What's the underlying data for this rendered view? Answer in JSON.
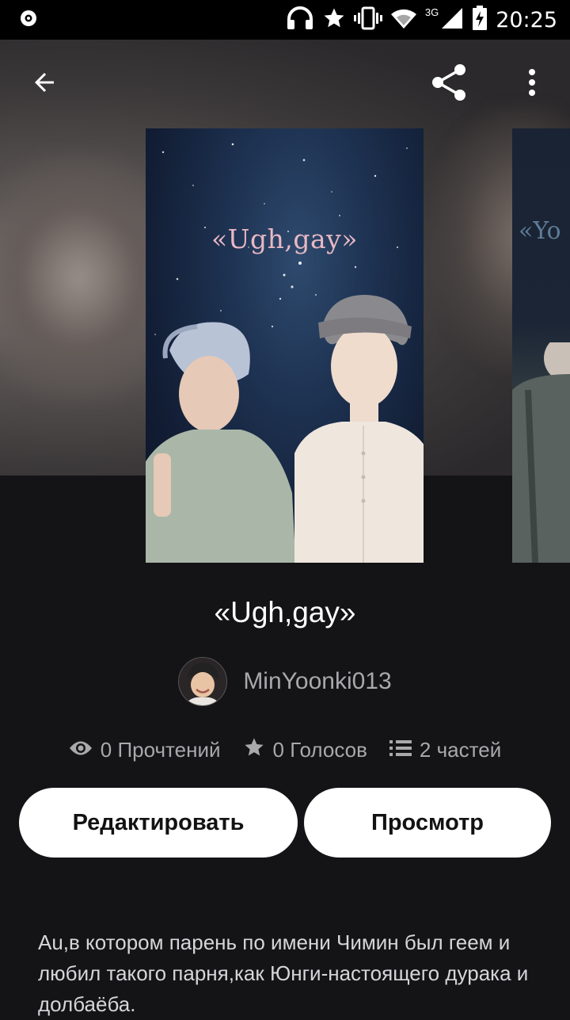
{
  "status_bar": {
    "time": "20:25",
    "network": "3G",
    "icons": [
      "record-icon",
      "headphones-icon",
      "star-icon",
      "vibrate-icon",
      "wifi-icon",
      "signal-icon",
      "battery-charging-icon"
    ]
  },
  "app_bar": {
    "icons": [
      "back-arrow-icon",
      "share-icon",
      "more-vert-icon"
    ]
  },
  "cover": {
    "title": "«Ugh,gay»",
    "next_cover_title": "«Yo"
  },
  "story": {
    "title": "«Ugh,gay»",
    "author": "MinYoonki013"
  },
  "stats": {
    "reads": "0 Прочтений",
    "votes": "0 Голосов",
    "parts": "2 частей"
  },
  "actions": {
    "edit_label": "Редактировать",
    "view_label": "Просмотр"
  },
  "description": "Au,в котором парень по имени Чимин был геем и любил такого парня,как Юнги-настоящего дурака и долбаёба.",
  "colors": {
    "background": "#141316",
    "button_bg": "#ffffff",
    "muted_text": "#a9a8ab",
    "cover_title": "#e8b8c4"
  }
}
